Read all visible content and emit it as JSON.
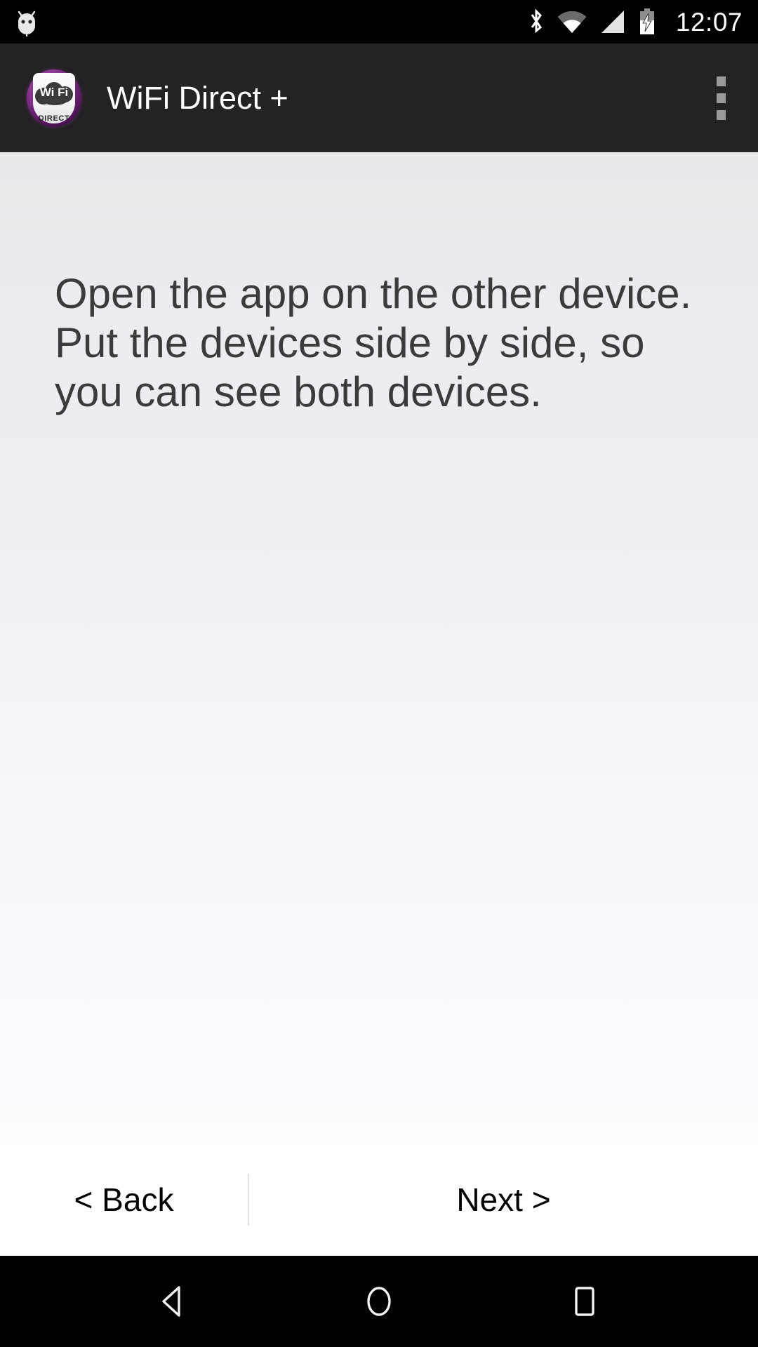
{
  "status_bar": {
    "notification_icon": "android-debug-icon",
    "icons": [
      "bluetooth-icon",
      "wifi-icon",
      "cellular-signal-icon",
      "battery-charging-icon"
    ],
    "clock": "12:07"
  },
  "app_bar": {
    "icon": {
      "name": "wifi-direct-app-icon",
      "primary_text": "Wi Fi",
      "secondary_text": "DIRECT",
      "accent_color": "#7d2e86"
    },
    "title": "WiFi Direct +",
    "overflow_menu": "overflow-menu-icon"
  },
  "content": {
    "instructions": "Open the app on the other device.\nPut the devices side by side, so you can see both devices.",
    "background_top_color": "#e9e8eb",
    "background_bottom_color": "#fdfcff",
    "text_color": "#3b3b3d"
  },
  "footer": {
    "back_label": "< Back",
    "next_label": "Next >"
  },
  "nav_bar": {
    "back": "nav-back-icon",
    "home": "nav-home-icon",
    "recents": "nav-recents-icon"
  }
}
